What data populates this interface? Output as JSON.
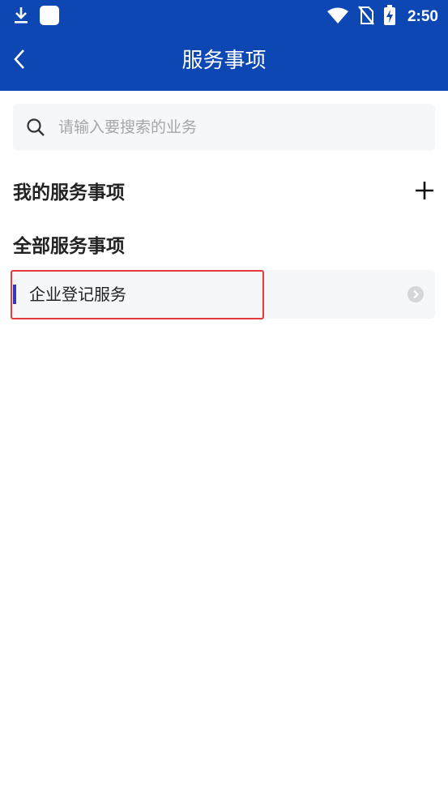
{
  "status_bar": {
    "time": "2:50",
    "icons": [
      "download-icon",
      "app-notification-icon",
      "wifi-icon",
      "no-sim-icon",
      "battery-charging-icon"
    ]
  },
  "nav": {
    "title": "服务事项",
    "back_icon": "chevron-left-icon"
  },
  "search": {
    "placeholder": "请输入要搜索的业务",
    "value": "",
    "icon": "search-icon"
  },
  "my_services": {
    "title": "我的服务事项",
    "add_icon": "plus-icon"
  },
  "all_services": {
    "title": "全部服务事项",
    "items": [
      {
        "label": "企业登记服务",
        "icon": "chevron-right-circle-icon"
      }
    ]
  },
  "colors": {
    "header": "#0c47b4",
    "accent": "#2d3db6",
    "highlight": "#e53a3a",
    "item_bg": "#f6f7f9"
  }
}
